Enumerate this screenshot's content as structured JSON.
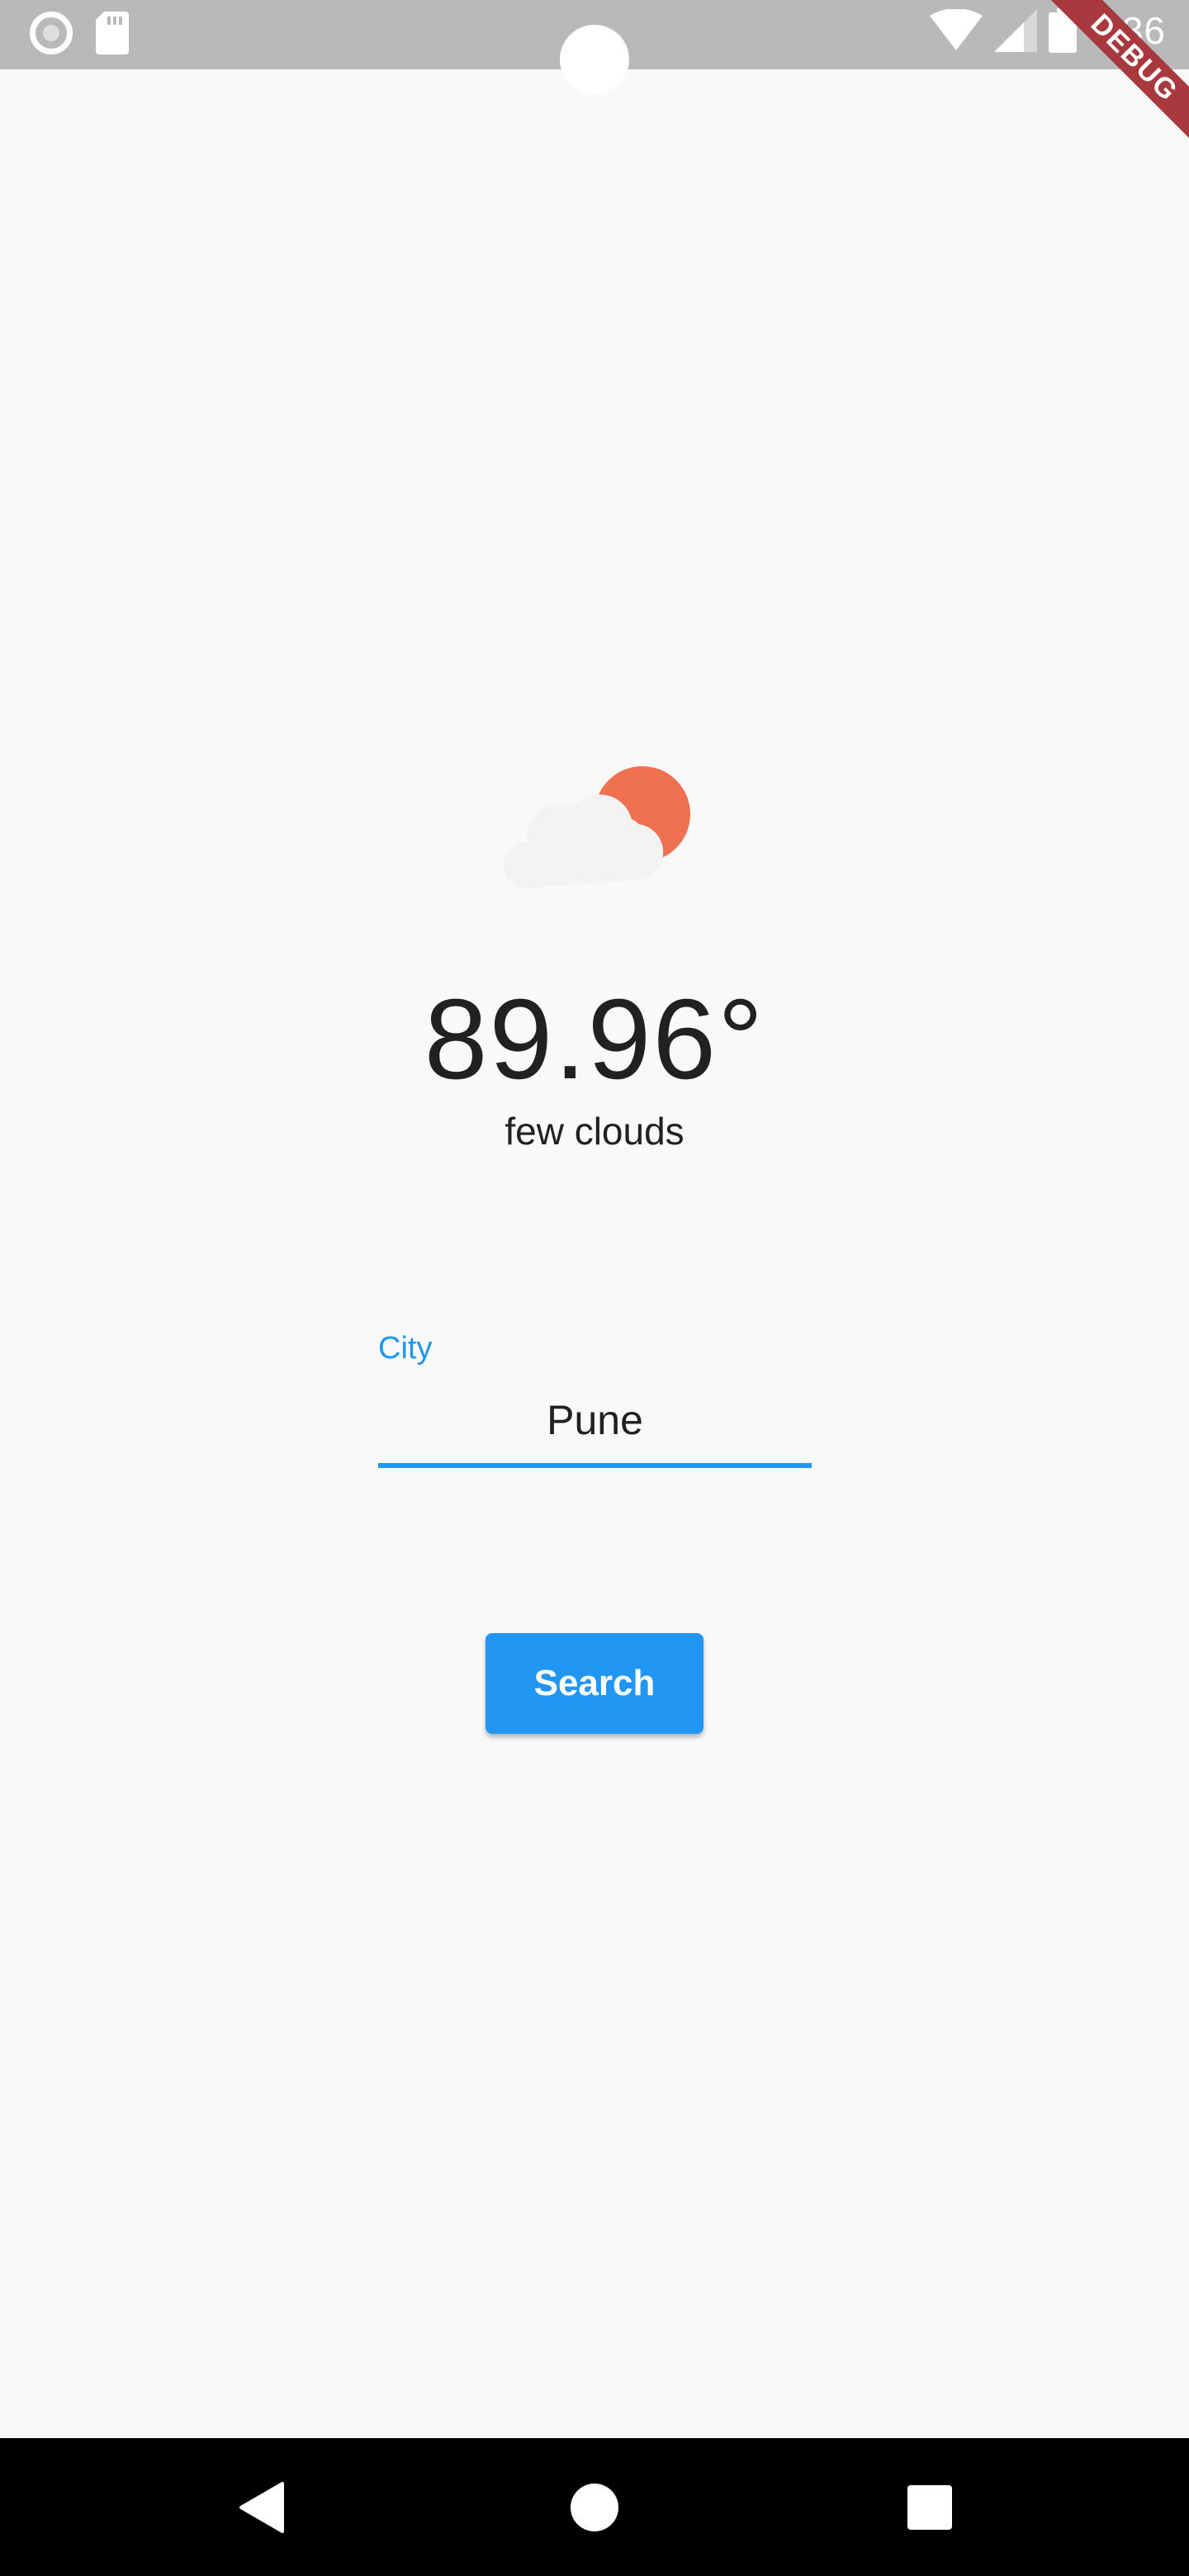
{
  "status_bar": {
    "time": "4:36",
    "icons": [
      "record-icon",
      "sd-card-icon",
      "wifi-icon",
      "signal-icon",
      "battery-icon"
    ]
  },
  "debug_banner": {
    "label": "DEBUG",
    "color": "#a8393e"
  },
  "weather": {
    "icon": "few-clouds-icon",
    "temperature": "89.96°",
    "description": "few clouds"
  },
  "city_field": {
    "label": "City",
    "value": "Pune",
    "accent": "#2196f3"
  },
  "search_button": {
    "label": "Search",
    "color": "#2196f3"
  },
  "nav_bar": {
    "buttons": [
      "back-icon",
      "home-icon",
      "recents-icon"
    ]
  }
}
